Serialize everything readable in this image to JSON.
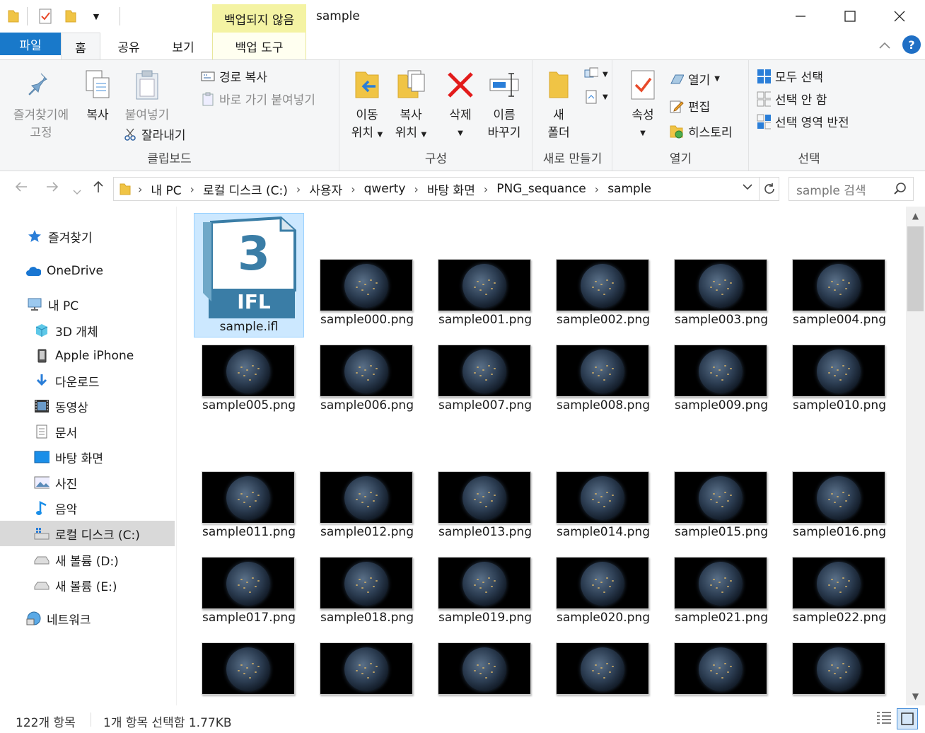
{
  "window": {
    "context_header": "백업되지 않음",
    "title": "sample"
  },
  "tabs": {
    "file": "파일",
    "home": "홈",
    "share": "공유",
    "view": "보기",
    "backup_tools": "백업 도구"
  },
  "ribbon": {
    "clipboard": {
      "label": "클립보드",
      "pin_line1": "즐겨찾기에",
      "pin_line2": "고정",
      "copy": "복사",
      "paste": "붙여넣기",
      "copy_path": "경로 복사",
      "paste_shortcut": "바로 가기 붙여넣기",
      "cut": "잘라내기"
    },
    "organize": {
      "label": "구성",
      "move_line1": "이동",
      "move_line2": "위치",
      "copyto_line1": "복사",
      "copyto_line2": "위치",
      "delete": "삭제",
      "rename_line1": "이름",
      "rename_line2": "바꾸기"
    },
    "new": {
      "label": "새로 만들기",
      "folder_line1": "새",
      "folder_line2": "폴더"
    },
    "open": {
      "label": "열기",
      "properties": "속성",
      "open": "열기",
      "edit": "편집",
      "history": "히스토리"
    },
    "select": {
      "label": "선택",
      "select_all": "모두 선택",
      "select_none": "선택 안 함",
      "invert": "선택 영역 반전"
    }
  },
  "address": {
    "crumbs": [
      "내 PC",
      "로컬 디스크 (C:)",
      "사용자",
      "qwerty",
      "바탕 화면",
      "PNG_sequance",
      "sample"
    ],
    "search_placeholder": "sample 검색"
  },
  "nav": {
    "favorites": "즐겨찾기",
    "onedrive": "OneDrive",
    "this_pc": "내 PC",
    "objects3d": "3D 개체",
    "iphone": "Apple iPhone",
    "downloads": "다운로드",
    "videos": "동영상",
    "documents": "문서",
    "desktop": "바탕 화면",
    "pictures": "사진",
    "music": "음악",
    "local_c": "로컬 디스크 (C:)",
    "vol_d": "새 볼륨 (D:)",
    "vol_e": "새 볼륨 (E:)",
    "network": "네트워크"
  },
  "files": {
    "ifl_badge_number": "3",
    "ifl_badge_text": "IFL",
    "items": [
      "sample.ifl",
      "sample000.png",
      "sample001.png",
      "sample002.png",
      "sample003.png",
      "sample004.png",
      "sample005.png",
      "sample006.png",
      "sample007.png",
      "sample008.png",
      "sample009.png",
      "sample010.png",
      "sample011.png",
      "sample012.png",
      "sample013.png",
      "sample014.png",
      "sample015.png",
      "sample016.png",
      "sample017.png",
      "sample018.png",
      "sample019.png",
      "sample020.png",
      "sample021.png",
      "sample022.png"
    ]
  },
  "status": {
    "count": "122개 항목",
    "selection": "1개 항목 선택함 1.77KB"
  },
  "colors": {
    "accent": "#1979ca",
    "context_tab": "#f4f3a3",
    "selection": "#cce8ff",
    "ifl_blue": "#3a7da6"
  }
}
